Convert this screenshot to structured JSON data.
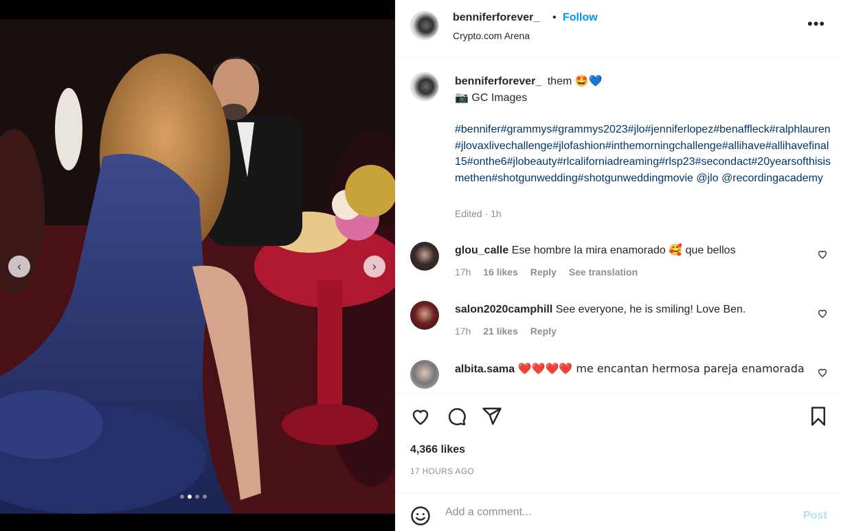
{
  "post": {
    "username": "benniferforever_",
    "separator": "•",
    "follow_label": "Follow",
    "location": "Crypto.com Arena",
    "more_label": "•••"
  },
  "caption": {
    "username": "benniferforever_",
    "text": "them",
    "emojis": "🤩💙",
    "credit": "📷 GC Images",
    "hashtags": "#bennifer#grammys#grammys2023#jlo#jenniferlopez#benaffleck#ralphlauren#jlovaxlivechallenge#jlofashion#inthemorningchallenge#allihave#allihavefinal15#onthe6#jlobeauty#rlcaliforniadreaming#rlsp23#secondact#20yearsofthisismethen#shotgunwedding#shotgunweddingmovie @jlo @recordingacademy",
    "edited": "Edited · 1h"
  },
  "comments": [
    {
      "username": "glou_calle",
      "text": "Ese hombre la mira enamorado 🥰 que bellos",
      "time": "17h",
      "likes": "16 likes",
      "reply": "Reply",
      "translate": "See translation"
    },
    {
      "username": "salon2020camphill",
      "text": "See everyone, he is smiling! Love Ben.",
      "time": "17h",
      "likes": "21 likes",
      "reply": "Reply"
    },
    {
      "username": "albita.sama",
      "text": "❤️❤️❤️❤️ me encantan hermosa pareja enamorada"
    }
  ],
  "stats": {
    "likes": "4,366 likes",
    "time_ago": "17 HOURS AGO"
  },
  "composer": {
    "placeholder": "Add a comment...",
    "post_label": "Post"
  },
  "carousel": {
    "prev": "‹",
    "next": "›",
    "active_index": 1,
    "count": 4
  },
  "icons": {
    "like": "heart-icon",
    "comment": "comment-bubble-icon",
    "share": "paper-plane-icon",
    "save": "bookmark-icon",
    "emoji": "smiley-icon"
  },
  "colors": {
    "link": "#0095f6",
    "hashtag": "#00376b",
    "muted": "#8e8e8e",
    "post_disabled": "#b2dffc"
  }
}
